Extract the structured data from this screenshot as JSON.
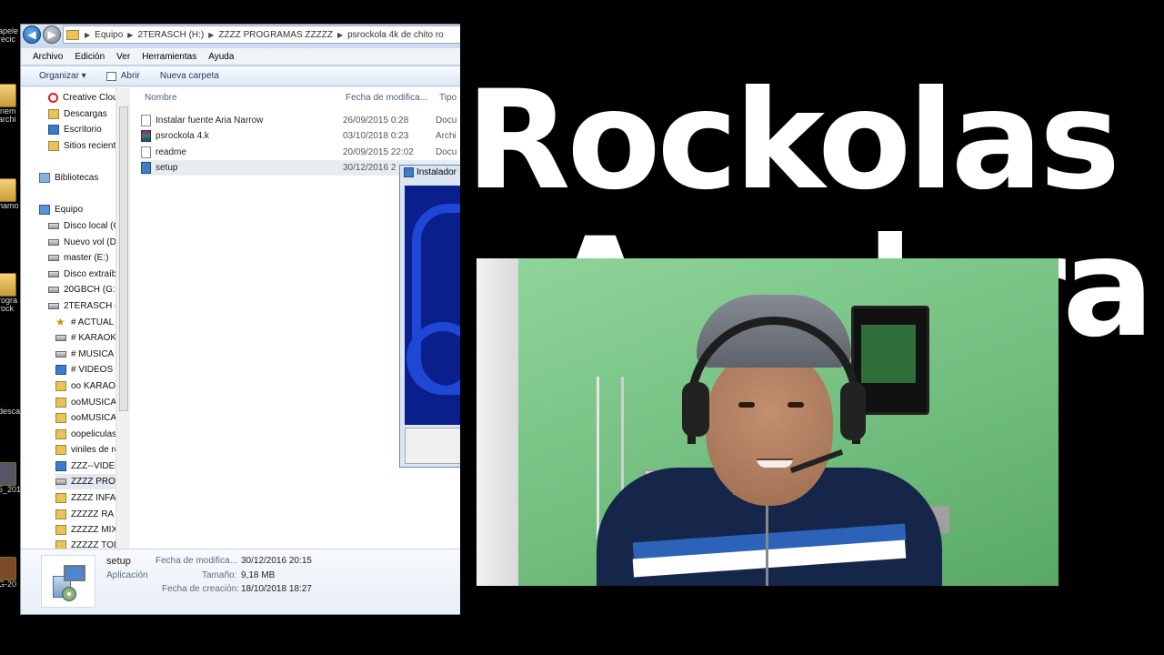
{
  "desktop": {
    "icons": [
      {
        "label": "apele\nrecic"
      },
      {
        "label": "inem\narchi"
      },
      {
        "label": "hamo"
      },
      {
        "label": "rogra\nrock"
      },
      {
        "label": "desca"
      },
      {
        "label": "5_201"
      },
      {
        "label": "G-20"
      }
    ]
  },
  "explorer": {
    "breadcrumb": [
      "Equipo",
      "2TERASCH (H:)",
      "ZZZZ  PROGRAMAS  ZZZZZ",
      "psrockola 4k de chito ro"
    ],
    "menu": [
      "Archivo",
      "Edición",
      "Ver",
      "Herramientas",
      "Ayuda"
    ],
    "toolbar": {
      "organize": "Organizar ▾",
      "open": "Abrir",
      "new_folder": "Nueva carpeta"
    },
    "nav": [
      {
        "label": "Creative Clou",
        "icon": "cc"
      },
      {
        "label": "Descargas",
        "icon": "folder"
      },
      {
        "label": "Escritorio",
        "icon": "blue"
      },
      {
        "label": "Sitios recient",
        "icon": "folder"
      },
      {
        "label": "Bibliotecas",
        "icon": "lib"
      },
      {
        "label": "Equipo",
        "icon": "pc"
      },
      {
        "label": "Disco local (C",
        "icon": "drive"
      },
      {
        "label": "Nuevo vol (D",
        "icon": "drive"
      },
      {
        "label": "master (E:)",
        "icon": "drive"
      },
      {
        "label": "Disco extraíb",
        "icon": "drive"
      },
      {
        "label": "20GBCH (G:)",
        "icon": "drive"
      },
      {
        "label": "2TERASCH (H",
        "icon": "drive"
      },
      {
        "label": "#  ACTUAL",
        "icon": "star"
      },
      {
        "label": "#  KARAOK",
        "icon": "drive"
      },
      {
        "label": "#  MUSICA",
        "icon": "drive"
      },
      {
        "label": "#  VIDEOS -",
        "icon": "blue"
      },
      {
        "label": "oo KARAOI",
        "icon": "folder"
      },
      {
        "label": "ooMUSICA",
        "icon": "folder"
      },
      {
        "label": "ooMUSICA",
        "icon": "folder"
      },
      {
        "label": "oopeliculas",
        "icon": "folder"
      },
      {
        "label": "viniles de ro",
        "icon": "folder"
      },
      {
        "label": "ZZZ--VIDEO",
        "icon": "blue"
      },
      {
        "label": "ZZZZ  PRO",
        "icon": "drive"
      },
      {
        "label": "ZZZZ INFA",
        "icon": "folder"
      },
      {
        "label": "ZZZZZ   RA",
        "icon": "folder"
      },
      {
        "label": "ZZZZZ MIX",
        "icon": "folder"
      },
      {
        "label": "ZZZZZ TOD",
        "icon": "folder"
      }
    ],
    "columns": {
      "name": "Nombre",
      "date": "Fecha de modifica...",
      "type": "Tipo"
    },
    "files": [
      {
        "name": "Instalar fuente Aria Narrow",
        "date": "26/09/2015 0:28",
        "type": "Docu",
        "icon": "doc"
      },
      {
        "name": "psrockola 4.k",
        "date": "03/10/2018 0:23",
        "type": "Archi",
        "icon": "rar"
      },
      {
        "name": "readme",
        "date": "20/09/2015 22:02",
        "type": "Docu",
        "icon": "doc"
      },
      {
        "name": "setup",
        "date": "30/12/2016 2",
        "type": "",
        "icon": "setup"
      }
    ],
    "details": {
      "name": "setup",
      "kind": "Aplicación",
      "modified_label": "Fecha de modifica...",
      "modified_value": "30/12/2016 20:15",
      "size_label": "Tamaño:",
      "size_value": "9,18 MB",
      "created_label": "Fecha de creación:",
      "created_value": "18/10/2018 18:27"
    }
  },
  "installer": {
    "title": "Instalador"
  },
  "overlay": {
    "line1": "Rockolas",
    "line2": "Arrolera"
  }
}
